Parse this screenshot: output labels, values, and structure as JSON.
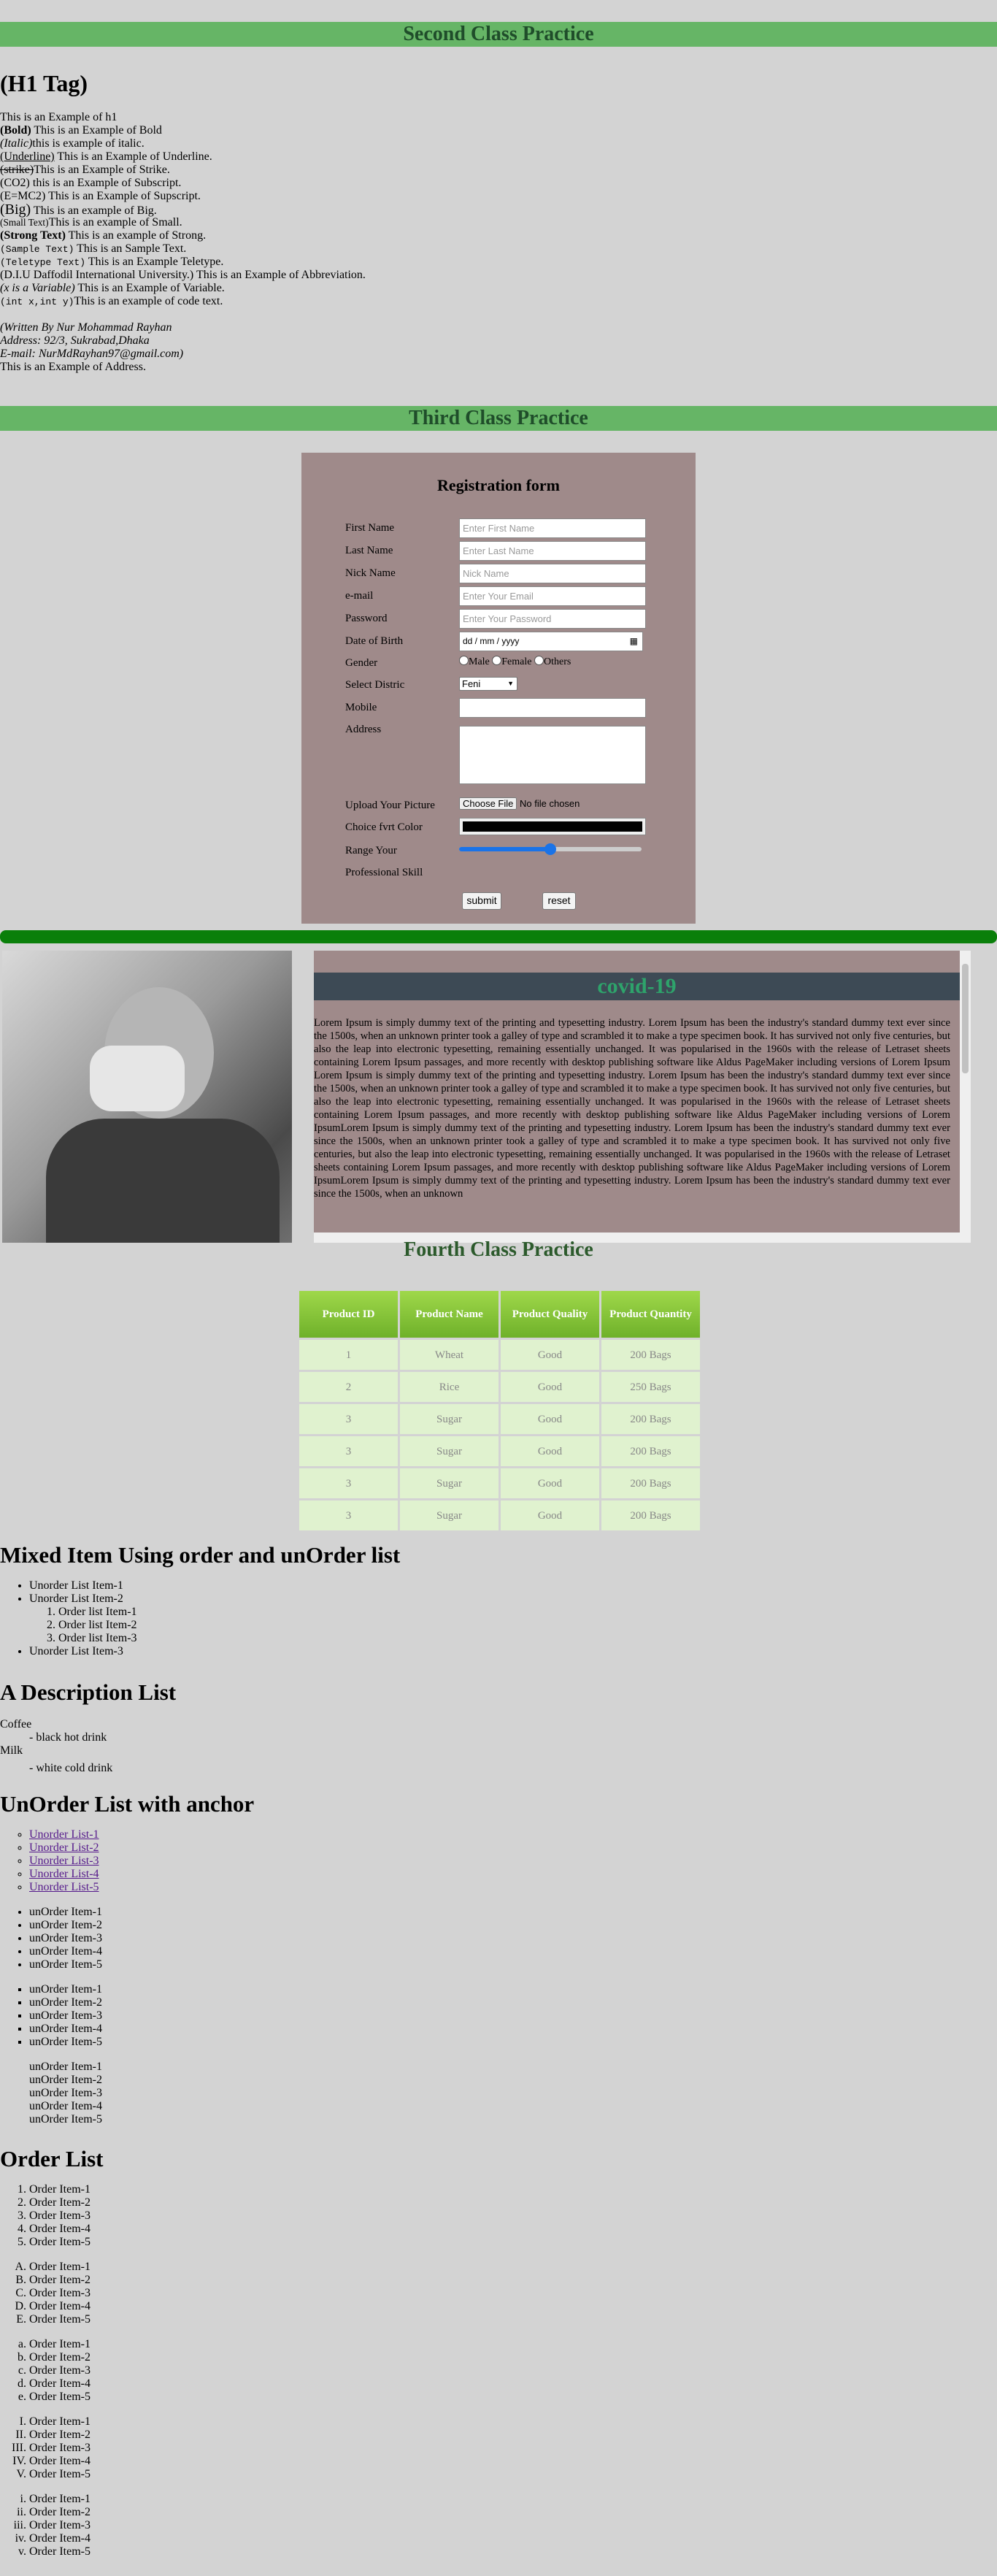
{
  "sec2": {
    "banner": "Second Class Practice",
    "h1": "(H1 Tag)",
    "lines": [
      {
        "a": "",
        "b": "This is an Example of h1"
      },
      {
        "a": "(Bold)",
        "b": " This is an Example of Bold"
      },
      {
        "a": "(Italic)",
        "b": "this is example of italic."
      },
      {
        "a": "(Underline)",
        "b": " This is an Example of Underline."
      },
      {
        "a": "(strike)",
        "b": "This is an Example of Strike."
      },
      {
        "a": "(CO2)",
        "b": " this is an Example of Subscript."
      },
      {
        "a": "(E=MC2)",
        "b": " This is an Example of Supscript."
      },
      {
        "a": "(Big)",
        "b": " This is an example of Big."
      },
      {
        "a": "(Small Text)",
        "b": "This is an example of Small."
      },
      {
        "a": "(Strong Text)",
        "b": " This is an example of Strong."
      },
      {
        "a": "(Sample Text)",
        "b": " This is an Sample Text."
      },
      {
        "a": "(Teletype Text)",
        "b": " This is an Example Teletype."
      },
      {
        "a": "(D.I.U Daffodil International University.)",
        "b": " This is an Example of Abbreviation."
      },
      {
        "a": "(x is a Variable)",
        "b": " This is an Example of Variable."
      },
      {
        "a": "(int x,int y)",
        "b": "This is an example of code text."
      }
    ],
    "address": [
      "(Written By Nur Mohammad Rayhan",
      "Address: 92/3, Sukrabad,Dhaka",
      "E-mail: NurMdRayhan97@gmail.com)"
    ],
    "address_after": "This is an Example of Address."
  },
  "sec3": {
    "banner": "Third Class Practice",
    "form_title": "Registration form",
    "first_name": "First Name",
    "first_name_ph": "Enter First Name",
    "last_name": "Last Name",
    "last_name_ph": "Enter Last Name",
    "nick_name": "Nick Name",
    "nick_name_ph": "Nick Name",
    "email": "e-mail",
    "email_ph": "Enter Your Email",
    "password": "Password",
    "password_ph": "Enter Your Password",
    "dob": "Date of Birth",
    "dob_val": "dd / mm / yyyy",
    "gender": "Gender",
    "male": "Male",
    "female": "Female",
    "others": "Others",
    "district": "Select Distric",
    "district_val": "Feni",
    "mobile": "Mobile",
    "address": "Address",
    "upload": "Upload Your Picture",
    "choose_file": "Choose File",
    "no_file": "No file chosen",
    "color": "Choice fvrt Color",
    "color_val": "#000000",
    "range": "Range Your",
    "range_val": 0.5,
    "skill": "Professional Skill",
    "submit": "submit",
    "reset": "reset"
  },
  "covid": {
    "title": "covid-19",
    "text": "Lorem Ipsum is simply dummy text of the printing and typesetting industry. Lorem Ipsum has been the industry's standard dummy text ever since the 1500s, when an unknown printer took a galley of type and scrambled it to make a type specimen book. It has survived not only five centuries, but also the leap into electronic typesetting, remaining essentially unchanged. It was popularised in the 1960s with the release of Letraset sheets containing Lorem Ipsum passages, and more recently with desktop publishing software like Aldus PageMaker including versions of Lorem Ipsum Lorem Ipsum is simply dummy text of the printing and typesetting industry. Lorem Ipsum has been the industry's standard dummy text ever since the 1500s, when an unknown printer took a galley of type and scrambled it to make a type specimen book. It has survived not only five centuries, but also the leap into electronic typesetting, remaining essentially unchanged. It was popularised in the 1960s with the release of Letraset sheets containing Lorem Ipsum passages, and more recently with desktop publishing software like Aldus PageMaker including versions of Lorem IpsumLorem Ipsum is simply dummy text of the printing and typesetting industry. Lorem Ipsum has been the industry's standard dummy text ever since the 1500s, when an unknown printer took a galley of type and scrambled it to make a type specimen book. It has survived not only five centuries, but also the leap into electronic typesetting, remaining essentially unchanged. It was popularised in the 1960s with the release of Letraset sheets containing Lorem Ipsum passages, and more recently with desktop publishing software like Aldus PageMaker including versions of Lorem IpsumLorem Ipsum is simply dummy text of the printing and typesetting industry. Lorem Ipsum has been the industry's standard dummy text ever since the 1500s, when an unknown"
  },
  "sec4": {
    "title": "Fourth Class Practice",
    "headers": [
      "Product ID",
      "Product Name",
      "Product Quality",
      "Product Quantity"
    ],
    "rows": [
      [
        "1",
        "Wheat",
        "Good",
        "200 Bags"
      ],
      [
        "2",
        "Rice",
        "Good",
        "250 Bags"
      ],
      [
        "3",
        "Sugar",
        "Good",
        "200 Bags"
      ],
      [
        "3",
        "Sugar",
        "Good",
        "200 Bags"
      ],
      [
        "3",
        "Sugar",
        "Good",
        "200 Bags"
      ],
      [
        "3",
        "Sugar",
        "Good",
        "200 Bags"
      ]
    ]
  },
  "mixed": {
    "title": "Mixed Item Using order and unOrder list",
    "ul": [
      "Unorder List Item-1",
      "Unorder List Item-2",
      "Unorder List Item-3"
    ],
    "ol": [
      "Order list Item-1",
      "Order list Item-2",
      "Order list Item-3"
    ]
  },
  "desc": {
    "title": "A Description List",
    "items": [
      {
        "dt": "Coffee",
        "dd": "- black hot drink"
      },
      {
        "dt": "Milk",
        "dd": "- white cold drink"
      }
    ]
  },
  "anchor": {
    "title": "UnOrder List with anchor",
    "links": [
      "Unorder List-1",
      "Unorder List-2",
      "Unorder List-3",
      "Unorder List-4",
      "Unorder List-5"
    ],
    "items": [
      "unOrder Item-1",
      "unOrder Item-2",
      "unOrder Item-3",
      "unOrder Item-4",
      "unOrder Item-5"
    ]
  },
  "order": {
    "title": "Order List",
    "items": [
      "Order Item-1",
      "Order Item-2",
      "Order Item-3",
      "Order Item-4",
      "Order Item-5"
    ]
  }
}
